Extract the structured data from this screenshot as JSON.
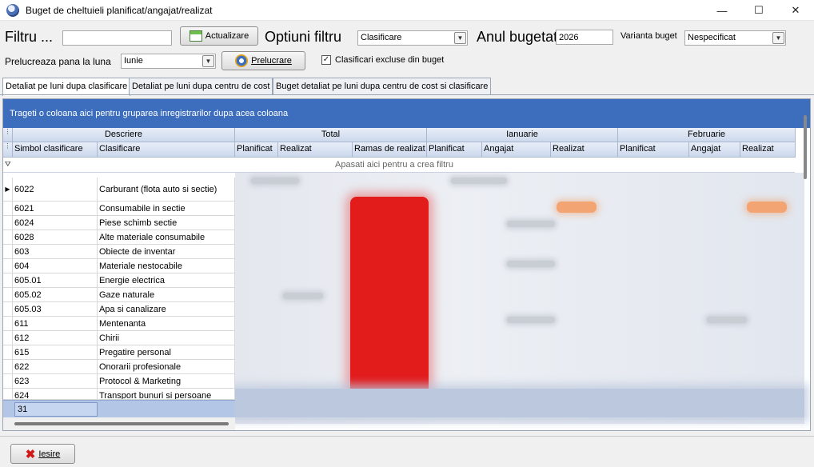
{
  "window": {
    "title": "Buget de cheltuieli planificat/angajat/realizat",
    "minimize": "—",
    "maximize": "☐",
    "close": "✕"
  },
  "toolbar": {
    "filtru_label": "Filtru ...",
    "filtru_value": "",
    "actualizare_label": "Actualizare",
    "optiuni_label": "Optiuni filtru",
    "optiuni_value": "Clasificare",
    "anul_label": "Anul bugetat",
    "anul_value": "2026",
    "varianta_label": "Varianta buget",
    "varianta_value": "Nespecificat",
    "prelucreaza_label": "Prelucreaza pana la luna",
    "luna_value": "Iunie",
    "prelucrare_label": "Prelucrare",
    "excluse_label": "Clasificari excluse din buget",
    "excluse_checked": "✓"
  },
  "tabs": [
    {
      "label": "Detaliat pe luni dupa clasificare"
    },
    {
      "label": "Detaliat pe luni dupa centru de cost"
    },
    {
      "label": "Buget detaliat pe luni dupa centru de cost si clasificare"
    }
  ],
  "grid": {
    "group_hint": "Trageti o coloana aici pentru gruparea inregistrarilor dupa acea coloana",
    "bands": {
      "descriere": "Descriere",
      "total": "Total",
      "ianuarie": "Ianuarie",
      "februarie": "Februarie"
    },
    "columns": {
      "simbol": "Simbol clasificare",
      "clasificare": "Clasificare",
      "total_planificat": "Planificat",
      "total_realizat": "Realizat",
      "total_ramas": "Ramas de realizat",
      "ian_planificat": "Planificat",
      "ian_angajat": "Angajat",
      "ian_realizat": "Realizat",
      "feb_planificat": "Planificat",
      "feb_angajat": "Angajat",
      "feb_realizat": "Realizat"
    },
    "filter_hint": "Apasati aici pentru a  crea filtru",
    "rows": [
      {
        "simbol": "6022",
        "clasificare": "Carburant (flota auto si sectie)"
      },
      {
        "simbol": "6021",
        "clasificare": "Consumabile in sectie"
      },
      {
        "simbol": "6024",
        "clasificare": "Piese schimb sectie"
      },
      {
        "simbol": "6028",
        "clasificare": "Alte materiale consumabile"
      },
      {
        "simbol": "603",
        "clasificare": "Obiecte de inventar"
      },
      {
        "simbol": "604",
        "clasificare": "Materiale nestocabile"
      },
      {
        "simbol": "605.01",
        "clasificare": "Energie electrica"
      },
      {
        "simbol": "605.02",
        "clasificare": "Gaze naturale"
      },
      {
        "simbol": "605.03",
        "clasificare": "Apa si canalizare"
      },
      {
        "simbol": "611",
        "clasificare": "Mentenanta"
      },
      {
        "simbol": "612",
        "clasificare": "Chirii"
      },
      {
        "simbol": "615",
        "clasificare": "Pregatire personal"
      },
      {
        "simbol": "622",
        "clasificare": "Onorarii profesionale"
      },
      {
        "simbol": "623",
        "clasificare": "Protocol & Marketing"
      },
      {
        "simbol": "624",
        "clasificare": "Transport bunuri si persoane"
      }
    ],
    "footer_count": "31"
  },
  "bottom": {
    "iesire_label": "Iesire"
  },
  "colors": {
    "group_panel": "#3d6dbd",
    "header": "#ccd8ec",
    "footer": "#b4c6e6",
    "highlight_red": "#e21b1b"
  }
}
